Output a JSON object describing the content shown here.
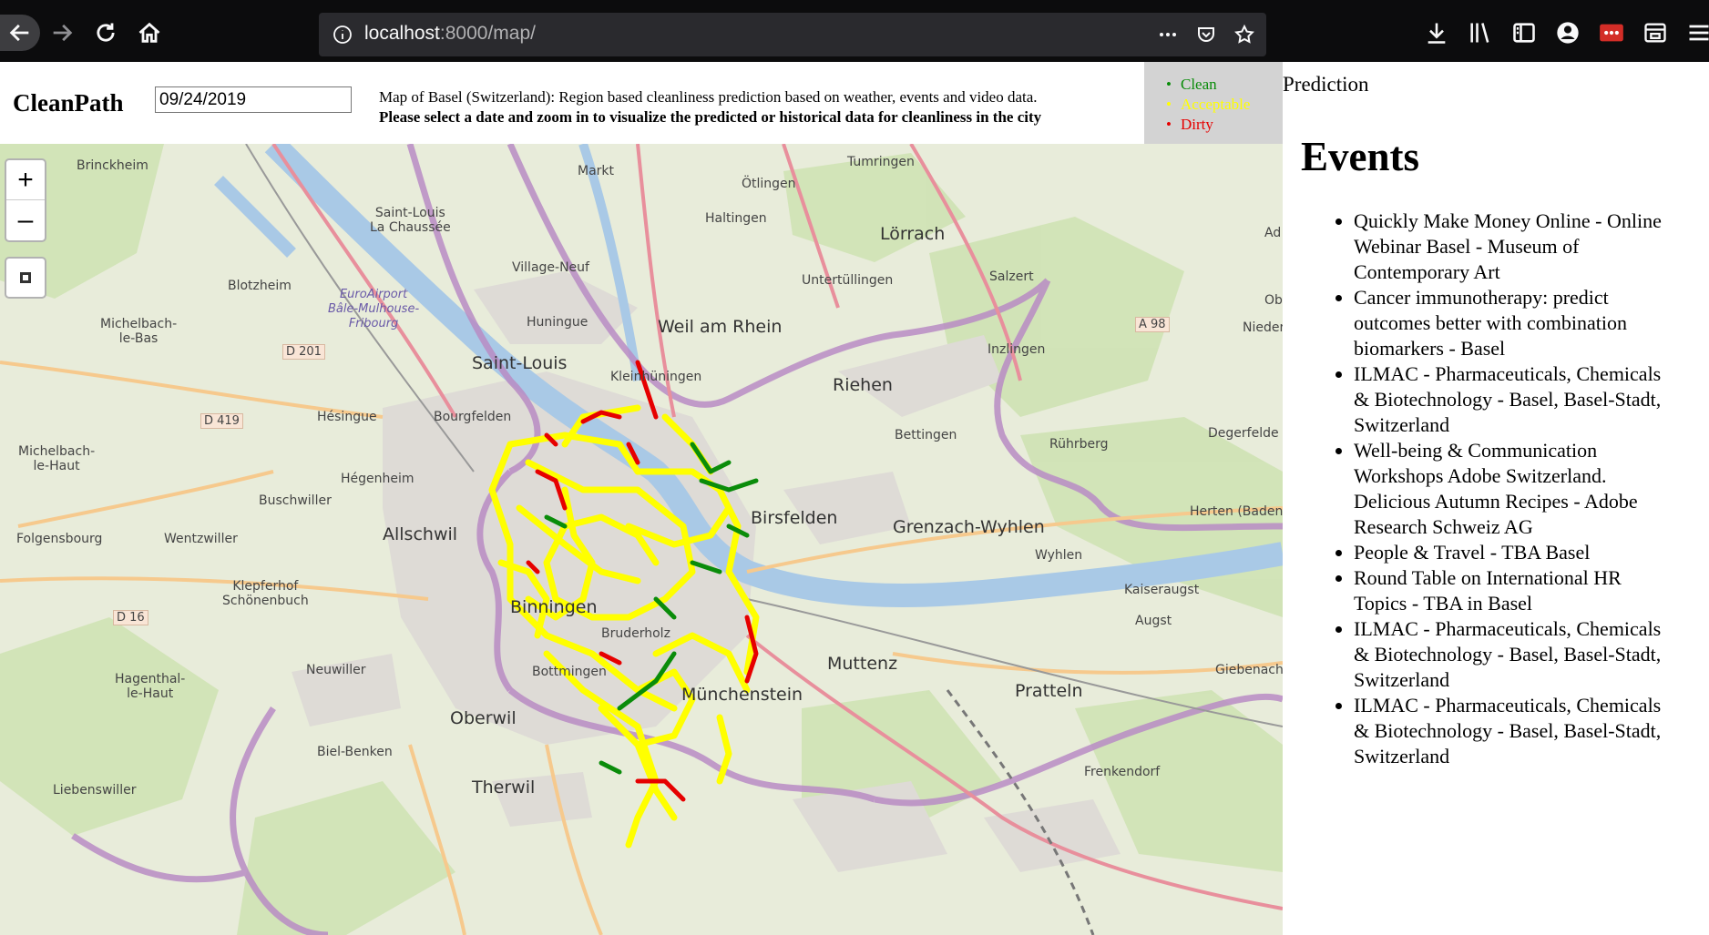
{
  "browser": {
    "url_host": "localhost",
    "url_rest": ":8000/map/"
  },
  "header": {
    "brand": "CleanPath",
    "date_value": "09/24/2019",
    "description": "Map of Basel (Switzerland): Region based cleanliness prediction based on weather, events and video data.",
    "instruction": "Please select a date and zoom in to visualize the predicted or historical data for cleanliness in the city"
  },
  "legend": {
    "items": [
      {
        "label": "Clean",
        "color": "#0a8c0a"
      },
      {
        "label": "Acceptable",
        "color": "#ffff00"
      },
      {
        "label": "Dirty",
        "color": "#e60000"
      }
    ]
  },
  "prediction_label": "Prediction",
  "map": {
    "zoom_in": "+",
    "zoom_out": "–",
    "places": {
      "brinckheim": "Brinckheim",
      "markt": "Markt",
      "tumringen": "Tumringen",
      "otlingen": "Ötlingen",
      "haltingen": "Haltingen",
      "lorrach": "Lörrach",
      "saint_louis_chaussee": "Saint-Louis\nLa Chaussée",
      "village_neuf": "Village-Neuf",
      "untertullingen": "Untertüllingen",
      "salzert": "Salzert",
      "blotzheim": "Blotzheim",
      "euroairport": "EuroAirport\nBâle-Mulhouse-\nFribourg",
      "huningue": "Huningue",
      "weil": "Weil am Rhein",
      "michelbach_bas": "Michelbach-\nle-Bas",
      "inzlingen": "Inzlingen",
      "saint_louis": "Saint-Louis",
      "kleinhuningen": "Kleinhüningen",
      "riehen": "Riehen",
      "hesingue": "Hésingue",
      "bourgfelden": "Bourgfelden",
      "bettingen": "Bettingen",
      "ruhrberg": "Rührberg",
      "degerfelden": "Degerfelde",
      "michelbach_haut": "Michelbach-\nle-Haut",
      "hegenheim": "Hégenheim",
      "buschwiller": "Buschwiller",
      "birsfelden": "Birsfelden",
      "grenzach": "Grenzach-Wyhlen",
      "herten": "Herten (Baden)",
      "allschwil": "Allschwil",
      "folgensbourg": "Folgensbourg",
      "wentzwiller": "Wentzwiller",
      "wyhlen": "Wyhlen",
      "kaiseraugst": "Kaiseraugst",
      "klepferhof": "Klepferhof\nSchönenbuch",
      "binningen": "Binningen",
      "augst": "Augst",
      "muttenz": "Muttenz",
      "giebenach": "Giebenach",
      "hagenthal": "Hagenthal-\nle-Haut",
      "neuwiller": "Neuwiller",
      "bottmingen": "Bottmingen",
      "pratteln": "Pratteln",
      "munchenstein": "Münchenstein",
      "oberwil": "Oberwil",
      "biel_benken": "Biel-Benken",
      "frenkendorf": "Frenkendorf",
      "liebenswiller": "Liebenswiller",
      "therwil": "Therwil",
      "bruderholz": "Bruderholz",
      "ad": "Ad",
      "ob": "Ob",
      "nieder": "Nieder"
    },
    "roads": {
      "d201": "D 201",
      "d419": "D 419",
      "d16": "D 16",
      "a98": "A 98"
    }
  },
  "events": {
    "title": "Events",
    "items": [
      "Quickly Make Money Online - Online Webinar Basel - Museum of Contemporary Art",
      "Cancer immunotherapy: predict outcomes better with combination biomarkers - Basel",
      "ILMAC - Pharmaceuticals, Chemicals & Biotechnology - Basel, Basel-Stadt, Switzerland",
      "Well-being & Communication Workshops Adobe Switzerland. Delicious Autumn Recipes - Adobe Research Schweiz AG",
      "People & Travel - TBA Basel",
      "Round Table on International HR Topics - TBA in Basel",
      "ILMAC - Pharmaceuticals, Chemicals & Biotechnology - Basel, Basel-Stadt, Switzerland",
      "ILMAC - Pharmaceuticals, Chemicals & Biotechnology - Basel, Basel-Stadt, Switzerland"
    ]
  }
}
